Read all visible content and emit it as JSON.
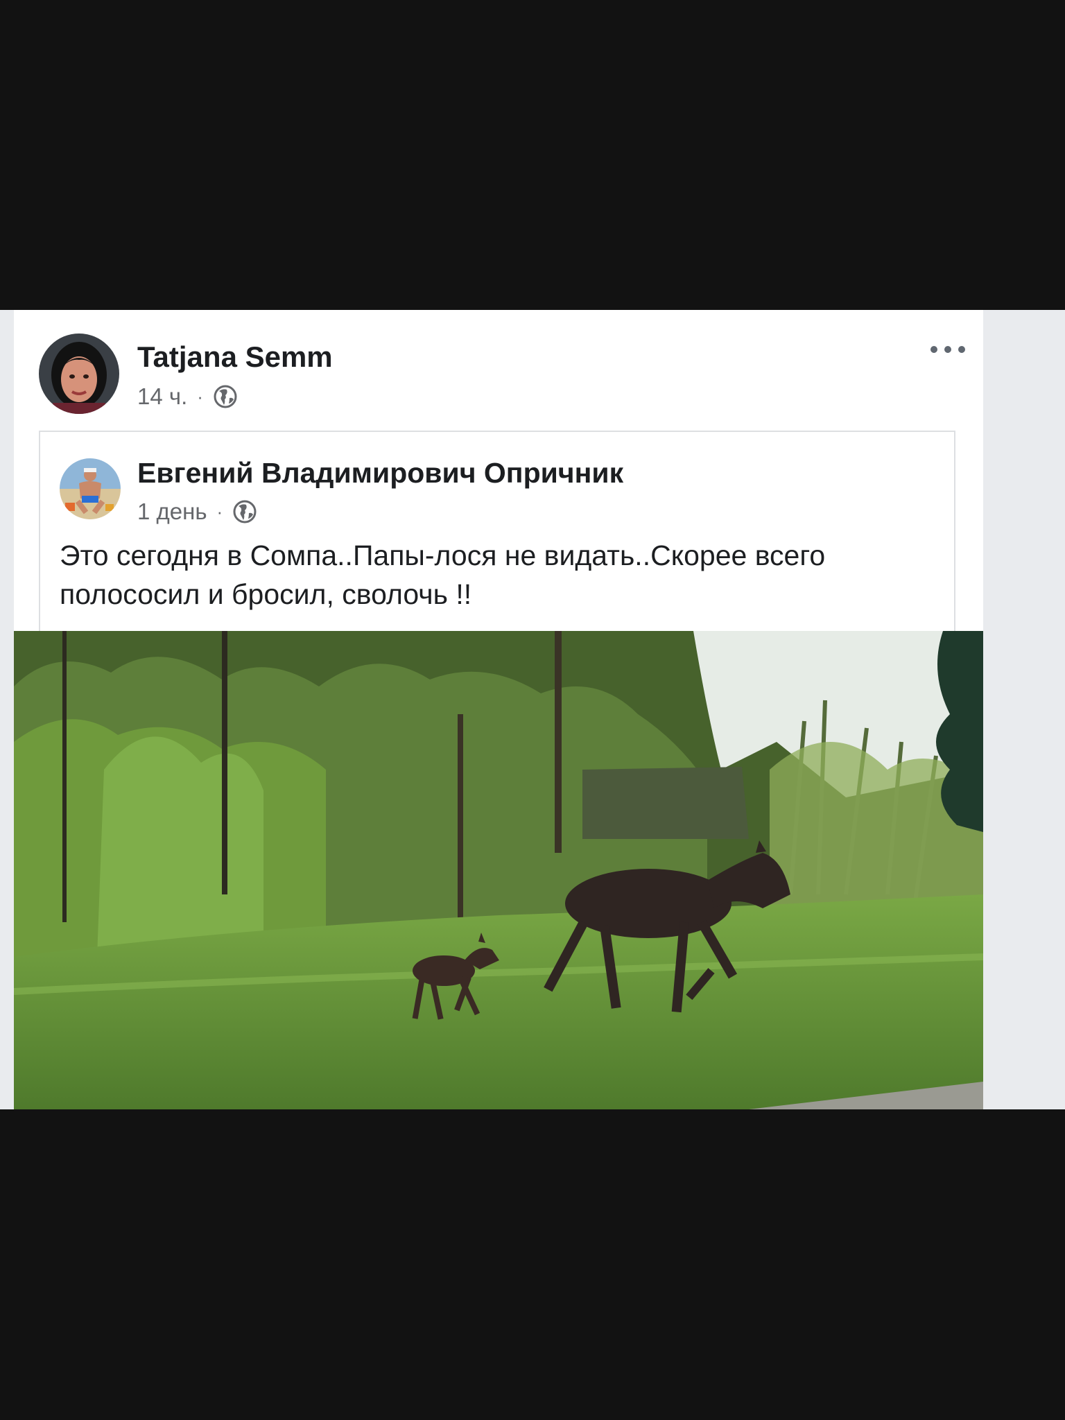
{
  "post": {
    "author": "Tatjana Semm",
    "time": "14 ч.",
    "separator": "·",
    "privacy_icon": "globe-icon",
    "more_icon": "more-options-icon"
  },
  "shared_post": {
    "author": "Евгений Владимирович Опричник",
    "time": "1 день",
    "separator": "·",
    "privacy_icon": "globe-icon",
    "text": "Это сегодня в Сомпа..Папы-лося не видать..Скорее всего полососил и бросил, сволочь !!"
  },
  "photo": {
    "colors": {
      "sky": "#e6ece6",
      "trees": "#5e7f3a",
      "grass": "#6f9a3c",
      "moose": "#2f2522"
    }
  }
}
